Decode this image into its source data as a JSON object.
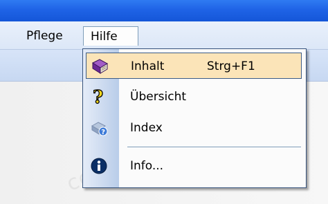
{
  "menubar": {
    "items": [
      {
        "label": "Pflege"
      },
      {
        "label": "Hilfe"
      }
    ]
  },
  "help_menu": {
    "items": [
      {
        "label": "Inhalt",
        "shortcut": "Strg+F1",
        "icon": "book-icon",
        "highlighted": true
      },
      {
        "label": "Übersicht",
        "icon": "question-mark-icon"
      },
      {
        "label": "Index",
        "icon": "help-index-icon"
      },
      {
        "label": "Info...",
        "icon": "info-icon"
      }
    ]
  },
  "colors": {
    "titlebar": "#1f63e6",
    "highlight": "#fbe4b8",
    "menu_border": "#36527b"
  }
}
